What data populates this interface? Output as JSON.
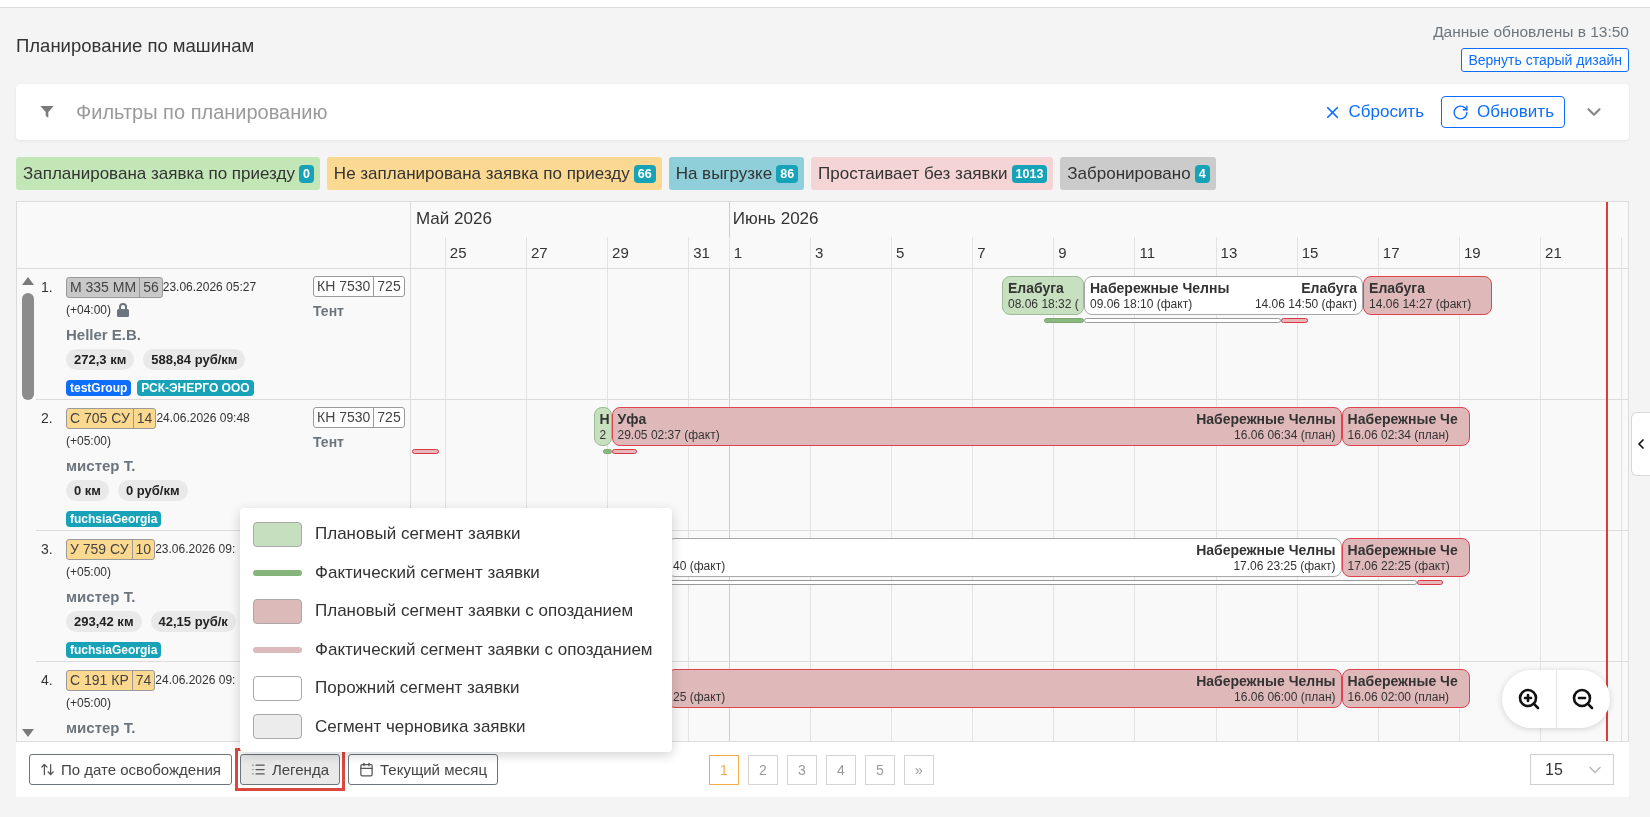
{
  "page": {
    "title": "Планирование по машинам",
    "updated": "Данные обновлены в 13:50",
    "old_design_button": "Вернуть старый дизайн"
  },
  "filters": {
    "placeholder": "Фильтры по планированию",
    "reset": "Сбросить",
    "refresh": "Обновить",
    "expanded": false
  },
  "status_chips": [
    {
      "label": "Запланирована заявка по приезду",
      "count": "0",
      "color": "#c3e6b7"
    },
    {
      "label": "Не запланирована заявка по приезду",
      "count": "66",
      "color": "#fbd992"
    },
    {
      "label": "На выгрузке",
      "count": "86",
      "color": "#8ecfda"
    },
    {
      "label": "Простаивает без заявки",
      "count": "1013",
      "color": "#f4d4d4"
    },
    {
      "label": "Забронировано",
      "count": "4",
      "color": "#cbcbcb"
    }
  ],
  "timeline": {
    "months": [
      {
        "label": "Май 2026",
        "days": [
          "25",
          "27",
          "29",
          "31"
        ]
      },
      {
        "label": "Июнь 2026",
        "days": [
          "1",
          "3",
          "5",
          "7",
          "9",
          "11",
          "13",
          "15",
          "17",
          "19",
          "21"
        ]
      }
    ]
  },
  "vehicles": [
    {
      "number": "1.",
      "plate": {
        "number": "М 335 ММ",
        "region": "56",
        "color": "#c8c8c8"
      },
      "free_at": "23.06.2026 05:27",
      "timezone": "(+04:00)",
      "locked": true,
      "driver": "Heller E.B.",
      "distance": "272,3 км",
      "rate": "588,84 руб/км",
      "tags": [
        {
          "label": "testGroup",
          "color": "#0d6efd"
        },
        {
          "label": "РСК-ЭНЕРГО ООО",
          "color": "#17a2b8"
        }
      ],
      "trailer": {
        "number": "КН 7530",
        "region": "725"
      },
      "body_type": "Тент",
      "segments": [
        {
          "kind": "plan",
          "left": {
            "title": "Елабуга",
            "subtitle": "08.06 18:32 ("
          }
        },
        {
          "kind": "empty",
          "left": {
            "title": "Набережные Челны",
            "subtitle": "09.06 18:10 (факт)"
          },
          "right": {
            "title": "Елабуга",
            "subtitle": "14.06 14:50 (факт)"
          }
        },
        {
          "kind": "late",
          "left": {
            "title": "Елабуга",
            "subtitle": "14.06 14:27 (факт)"
          }
        }
      ],
      "fact_lines": [
        {
          "kind": "fact"
        },
        {
          "kind": "empty"
        },
        {
          "kind": "late"
        }
      ]
    },
    {
      "number": "2.",
      "plate": {
        "number": "С 705 СУ",
        "region": "14",
        "color": "#fcd98f"
      },
      "free_at": "24.06.2026 09:48",
      "timezone": "(+05:00)",
      "locked": false,
      "driver": "мистер Т.",
      "distance": "0 км",
      "rate": "0 руб/км",
      "tags": [
        {
          "label": "fuchsiaGeorgia",
          "color": "#17a2b8"
        }
      ],
      "trailer": {
        "number": "КН 7530",
        "region": "725"
      },
      "body_type": "Тент",
      "segments": [
        {
          "kind": "plan",
          "left": {
            "title": "Н",
            "subtitle": "2"
          }
        },
        {
          "kind": "late",
          "left": {
            "title": "Уфа",
            "subtitle": "29.05 02:37 (факт)"
          },
          "right": {
            "title": "Набережные Челны",
            "subtitle": "16.06 06:34 (план)"
          }
        },
        {
          "kind": "late",
          "left": {
            "title": "Набережные Че",
            "subtitle": "16.06 02:34 (план)"
          }
        }
      ],
      "fact_lines": [
        {
          "kind": "late"
        },
        {
          "kind": "fact"
        },
        {
          "kind": "late"
        }
      ]
    },
    {
      "number": "3.",
      "plate": {
        "number": "У 759 СУ",
        "region": "10",
        "color": "#fcd98f"
      },
      "free_at": "23.06.2026 09:",
      "timezone": "(+05:00)",
      "locked": false,
      "driver": "мистер Т.",
      "distance": "293,42 км",
      "rate": "42,15 руб/к",
      "tags": [
        {
          "label": "fuchsiaGeorgia",
          "color": "#17a2b8"
        }
      ],
      "segments": [
        {
          "kind": "empty",
          "left": {
            "subtitle": "40 (факт)"
          },
          "right": {
            "title": "Набережные Челны",
            "subtitle": "17.06 23:25 (факт)"
          }
        },
        {
          "kind": "late",
          "left": {
            "title": "Набережные Че",
            "subtitle": "17.06 22:25 (факт)"
          }
        }
      ],
      "fact_lines": [
        {
          "kind": "empty"
        },
        {
          "kind": "late"
        }
      ]
    },
    {
      "number": "4.",
      "plate": {
        "number": "С 191 КР",
        "region": "74",
        "color": "#fcd98f"
      },
      "free_at": "24.06.2026 09:",
      "timezone": "(+05:00)",
      "locked": false,
      "driver": "мистер Т.",
      "segments": [
        {
          "kind": "late",
          "left": {
            "subtitle": "25 (факт)"
          },
          "right": {
            "title": "Набережные Челны",
            "subtitle": "16.06 06:00 (план)"
          }
        },
        {
          "kind": "late",
          "left": {
            "title": "Набережные Че",
            "subtitle": "16.06 02:00 (план)"
          }
        }
      ]
    }
  ],
  "legend": {
    "open": true,
    "items": [
      {
        "kind": "box",
        "color": "#c6e0bf",
        "label": "Плановый сегмент заявки"
      },
      {
        "kind": "line",
        "color": "#86b47a",
        "label": "Фактический сегмент заявки"
      },
      {
        "kind": "box",
        "color": "#dcbaba",
        "label": "Плановый сегмент заявки с опозданием"
      },
      {
        "kind": "line",
        "color": "#ddbabb",
        "label": "Фактический сегмент заявки с опозданием"
      },
      {
        "kind": "box",
        "color": "#ffffff",
        "label": "Порожний сегмент заявки"
      },
      {
        "kind": "box",
        "color": "#ececec",
        "label": "Сегмент черновика заявки"
      }
    ]
  },
  "toolbar_buttons": [
    {
      "kind": "sort",
      "label": "По дате освобождения",
      "pressed": false,
      "highlighted": false
    },
    {
      "kind": "legend",
      "label": "Легенда",
      "pressed": true,
      "highlighted": true
    },
    {
      "kind": "calendar",
      "label": "Текущий месяц",
      "pressed": false,
      "highlighted": false
    }
  ],
  "pagination": {
    "pages": [
      {
        "label": "1",
        "selected": true
      },
      {
        "label": "2",
        "selected": false
      },
      {
        "label": "3",
        "selected": false
      },
      {
        "label": "4",
        "selected": false
      },
      {
        "label": "5",
        "selected": false
      }
    ],
    "next": "»"
  },
  "page_size": "15"
}
